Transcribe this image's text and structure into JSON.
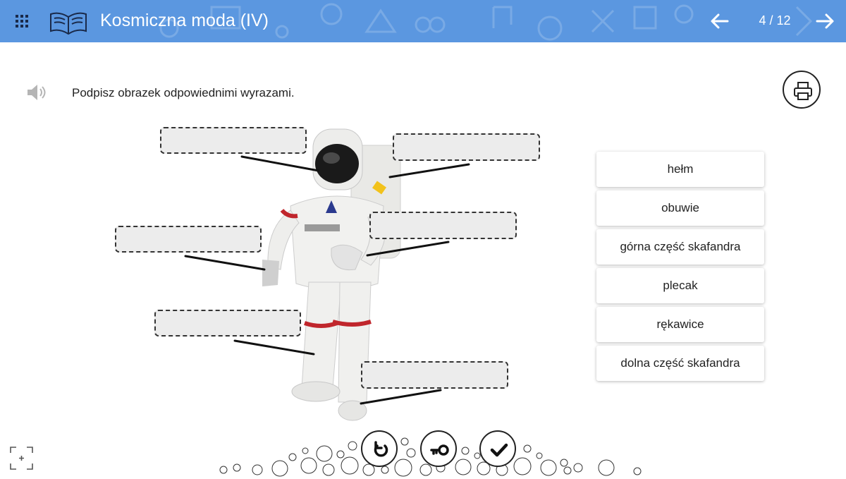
{
  "header": {
    "title": "Kosmiczna moda (IV)",
    "page_indicator": "4 / 12",
    "menu_icon": "grid-menu-icon",
    "logo_icon": "open-book-icon",
    "prev_icon": "arrow-left-icon",
    "next_icon": "arrow-right-icon",
    "background_color": "#5b97e0"
  },
  "task": {
    "instruction": "Podpisz obrazek odpowiednimi wyrazami.",
    "speaker_icon": "speaker-icon",
    "print_icon": "printer-icon"
  },
  "drop_zones": [
    {
      "id": "zone-1",
      "value": ""
    },
    {
      "id": "zone-2",
      "value": ""
    },
    {
      "id": "zone-3",
      "value": ""
    },
    {
      "id": "zone-4",
      "value": ""
    },
    {
      "id": "zone-5",
      "value": ""
    },
    {
      "id": "zone-6",
      "value": ""
    }
  ],
  "word_bank": [
    {
      "label": "hełm"
    },
    {
      "label": "obuwie"
    },
    {
      "label": "górna część skafandra"
    },
    {
      "label": "plecak"
    },
    {
      "label": "rękawice"
    },
    {
      "label": "dolna część skafandra"
    }
  ],
  "controls": {
    "reset_icon": "reset-icon",
    "key_icon": "key-icon",
    "check_icon": "check-icon",
    "fullscreen_icon": "fullscreen-icon"
  }
}
